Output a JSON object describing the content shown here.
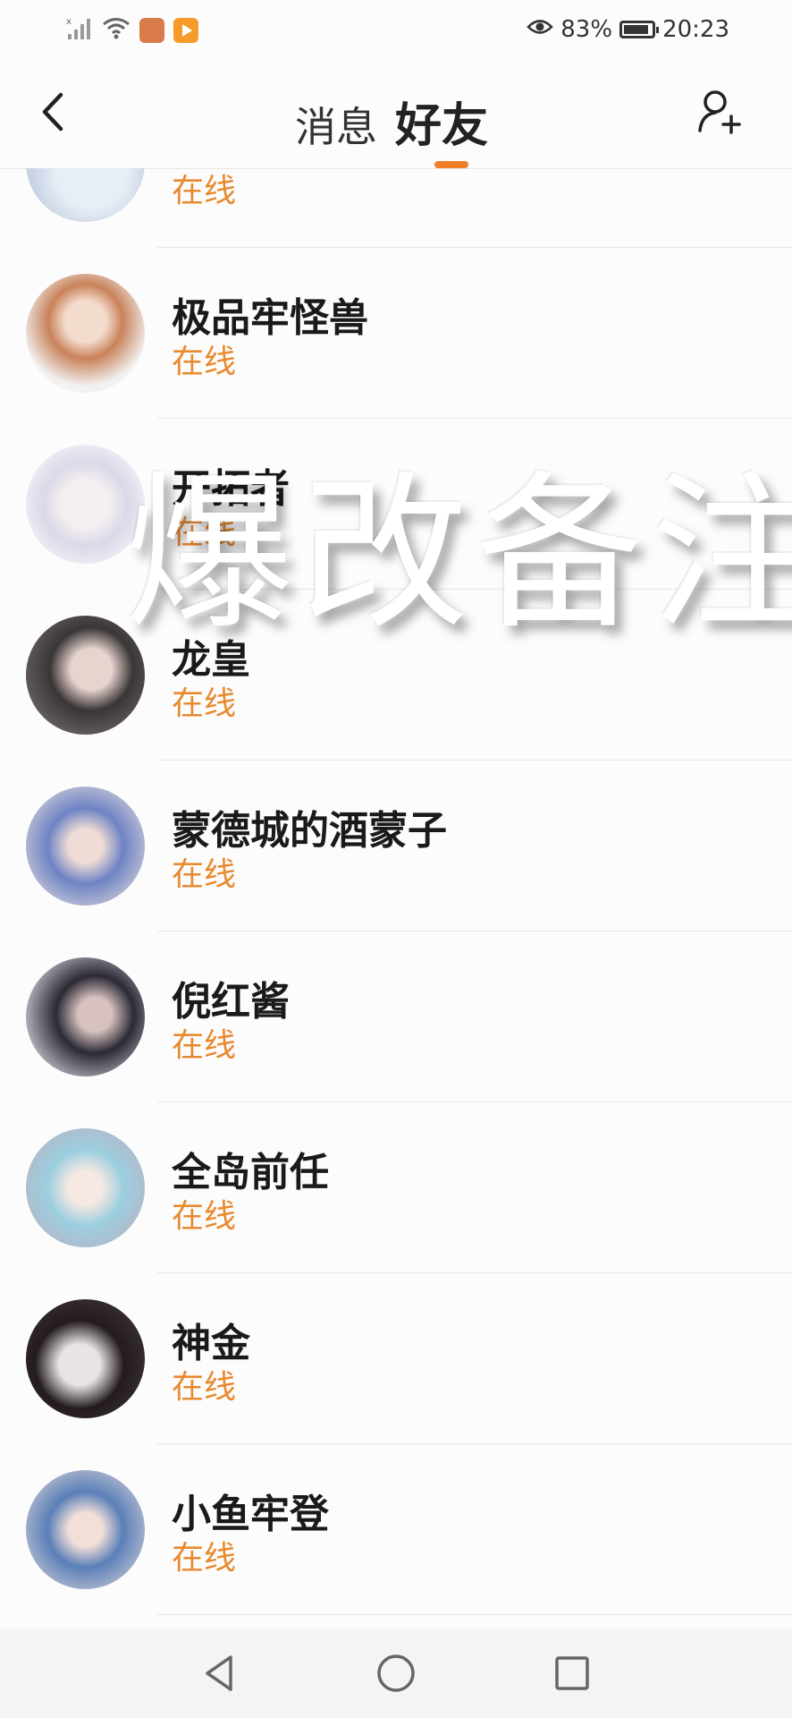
{
  "status_bar": {
    "battery": "83%",
    "time": "20:23"
  },
  "header": {
    "tab_messages": "消息",
    "tab_friends": "好友"
  },
  "friends": [
    {
      "name": "",
      "status": "在线",
      "avatar": "#c9d4e4"
    },
    {
      "name": "极品牢怪兽",
      "status": "在线",
      "avatar": "#c9825a"
    },
    {
      "name": "开拓者",
      "status": "在线",
      "avatar": "#d9d9e8"
    },
    {
      "name": "龙皇",
      "status": "在线",
      "avatar": "#3a3536"
    },
    {
      "name": "蒙德城的酒蒙子",
      "status": "在线",
      "avatar": "#6e83c4"
    },
    {
      "name": "倪红酱",
      "status": "在线",
      "avatar": "#2b2a35"
    },
    {
      "name": "全岛前任",
      "status": "在线",
      "avatar": "#9ccfe0"
    },
    {
      "name": "神金",
      "status": "在线",
      "avatar": "#231b1d"
    },
    {
      "name": "小鱼牢登",
      "status": "在线",
      "avatar": "#5a7fb8"
    }
  ],
  "overlay_text": "爆改备注",
  "colors": {
    "accent": "#f07f27",
    "online": "#e88a2e"
  }
}
